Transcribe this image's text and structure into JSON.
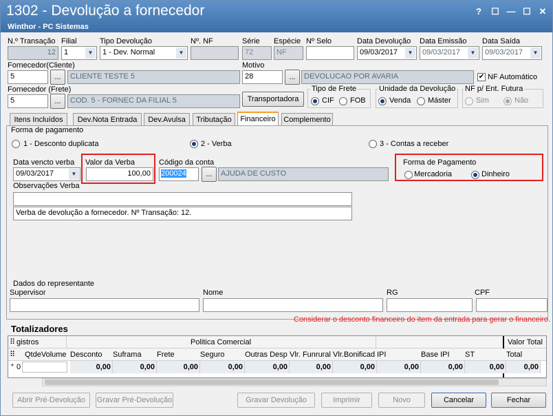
{
  "window": {
    "title": "1302 - Devolução a fornecedor",
    "subtitle": "Winthor - PC Sistemas"
  },
  "titlebar_buttons": [
    "?",
    "☐",
    "—",
    "☐",
    "✕"
  ],
  "header": {
    "transacao_label": "N.º Transação",
    "transacao_value": "12",
    "filial_label": "Filial",
    "filial_value": "1",
    "tipo_label": "Tipo Devolução",
    "tipo_value": "1 - Dev. Normal",
    "nf_label": "Nº. NF",
    "nf_value": "",
    "serie_label": "Série",
    "serie_value": "72",
    "especie_label": "Espécie",
    "especie_value": "NF",
    "selo_label": "Nº Selo",
    "selo_value": "",
    "data_dev_label": "Data Devolução",
    "data_dev_value": "09/03/2017",
    "data_emi_label": "Data Emissão",
    "data_emi_value": "09/03/2017",
    "data_saida_label": "Data Saída",
    "data_saida_value": "09/03/2017",
    "fornecedor_cli_label": "Fornecedor(Cliente)",
    "fornecedor_cli_code": "5",
    "fornecedor_cli_name": "CLIENTE TESTE 5",
    "motivo_label": "Motivo",
    "motivo_code": "28",
    "motivo_name": "DEVOLUCAO POR AVARIA",
    "nf_auto_label": "NF Automático",
    "fornecedor_frete_label": "Fornecedor (Frete)",
    "fornecedor_frete_code": "5",
    "fornecedor_frete_name": "COD. 5 - FORNEC DA FILIAL 5",
    "transportadora_button": "Transportadora",
    "tipo_frete_label": "Tipo de Frete",
    "cif_label": "CIF",
    "fob_label": "FOB",
    "unidade_label": "Unidade da Devolução",
    "venda_label": "Venda",
    "master_label": "Máster",
    "nf_ent_label": "NF p/ Ent. Futura",
    "sim_label": "Sim",
    "nao_label": "Não",
    "ellipsis": "..."
  },
  "tabs": [
    "Itens Incluídos",
    "Dev.Nota Entrada",
    "Dev.Avulsa",
    "Tributação",
    "Financeiro",
    "Complemento"
  ],
  "financeiro": {
    "forma_pag_title": "Forma de pagamento",
    "opt1": "1 - Desconto duplicata",
    "opt2": "2 - Verba",
    "opt3": "3 - Contas a receber",
    "data_venc_label": "Data vencto verba",
    "data_venc_value": "09/03/2017",
    "valor_label": "Valor da Verba",
    "valor_value": "100,00",
    "codigo_label": "Código da conta",
    "codigo_value": "200024",
    "codigo_name": "AJUDA DE CUSTO",
    "forma_pag2_label": "Forma de Pagamento",
    "mercadoria_label": "Mercadoria",
    "dinheiro_label": "Dinheiro",
    "obs_label": "Observações Verba",
    "obs_value": "",
    "obs2_value": "Verba de devolução a fornecedor. Nº Transação: 12."
  },
  "representante": {
    "title": "Dados do representante",
    "supervisor_label": "Supervisor",
    "nome_label": "Nome",
    "rg_label": "RG",
    "cpf_label": "CPF"
  },
  "totalizadores": {
    "title": "Totalizadores",
    "notice": "Considerar o desconto financeiro do item da entrada para gerar o financeiro.",
    "group_headers": [
      "gistros",
      "Politica Comercial",
      "Valor Total"
    ],
    "columns": [
      "QtdeVolume",
      "Desconto",
      "Suframa",
      "Frete",
      "Seguro",
      "Outras Desp",
      "Vlr. Funrural",
      "Vlr.Bonificad",
      "IPI",
      "Base IPI",
      "ST",
      "Total"
    ],
    "row": [
      "0",
      "0,00",
      "0,00",
      "0,00",
      "0,00",
      "0,00",
      "0,00",
      "0,00",
      "0,00",
      "0,00",
      "0,00",
      "0,00"
    ],
    "row_marker": "*"
  },
  "footer": {
    "abrir": "Abrir Pré-Devolução",
    "gravar_pre": "Gravar Pré-Devolução",
    "gravar": "Gravar Devolução",
    "imprimir": "Imprimir",
    "novo": "Novo",
    "cancelar": "Cancelar",
    "fechar": "Fechar"
  }
}
